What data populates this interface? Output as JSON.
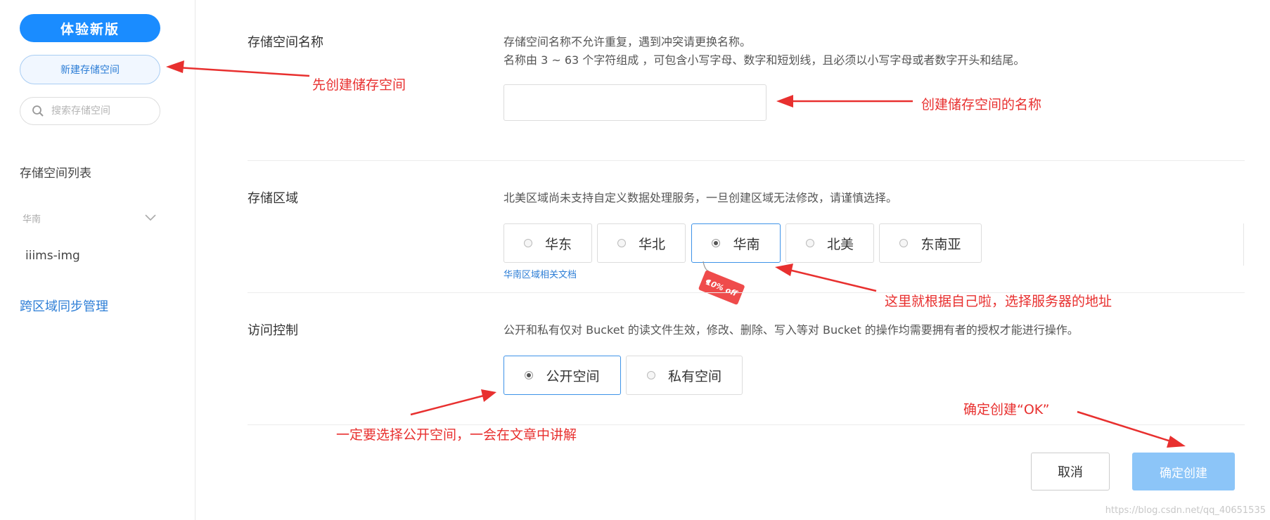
{
  "sidebar": {
    "new_version_label": "体验新版",
    "create_bucket_label": "新建存储空间",
    "search_placeholder": "搜索存储空间",
    "list_title": "存储空间列表",
    "region_selected": "华南",
    "buckets": [
      "iiims-img"
    ],
    "cross_region_label": "跨区域同步管理"
  },
  "form": {
    "name": {
      "label": "存储空间名称",
      "desc_line1": "存储空间名称不允许重复，遇到冲突请更换名称。",
      "desc_line2": "名称由 3 ~ 63 个字符组成 ，可包含小写字母、数字和短划线，且必须以小写字母或者数字开头和结尾。",
      "value": ""
    },
    "region": {
      "label": "存储区域",
      "desc": "北美区域尚未支持自定义数据处理服务，一旦创建区域无法修改，请谨慎选择。",
      "options": [
        "华东",
        "华北",
        "华南",
        "北美",
        "东南亚"
      ],
      "selected": "华南",
      "doc_link": "华南区域相关文档",
      "promo_tag": "10% off"
    },
    "access": {
      "label": "访问控制",
      "desc": "公开和私有仅对 Bucket 的读文件生效，修改、删除、写入等对 Bucket 的操作均需要拥有者的授权才能进行操作。",
      "options": [
        "公开空间",
        "私有空间"
      ],
      "selected": "公开空间"
    },
    "cancel_label": "取消",
    "confirm_label": "确定创建"
  },
  "annotations": {
    "create_first": "先创建储存空间",
    "name_hint": "创建储存空间的名称",
    "region_hint": "这里就根据自己啦，选择服务器的地址",
    "access_hint": "一定要选择公开空间，一会在文章中讲解",
    "confirm_hint": "确定创建“OK”"
  },
  "watermark": "https://blog.csdn.net/qq_40651535",
  "colors": {
    "primary": "#1a8cff",
    "link": "#2d7ed6",
    "confirm_disabled": "#8cc5f8",
    "annotation": "#e8302f"
  }
}
